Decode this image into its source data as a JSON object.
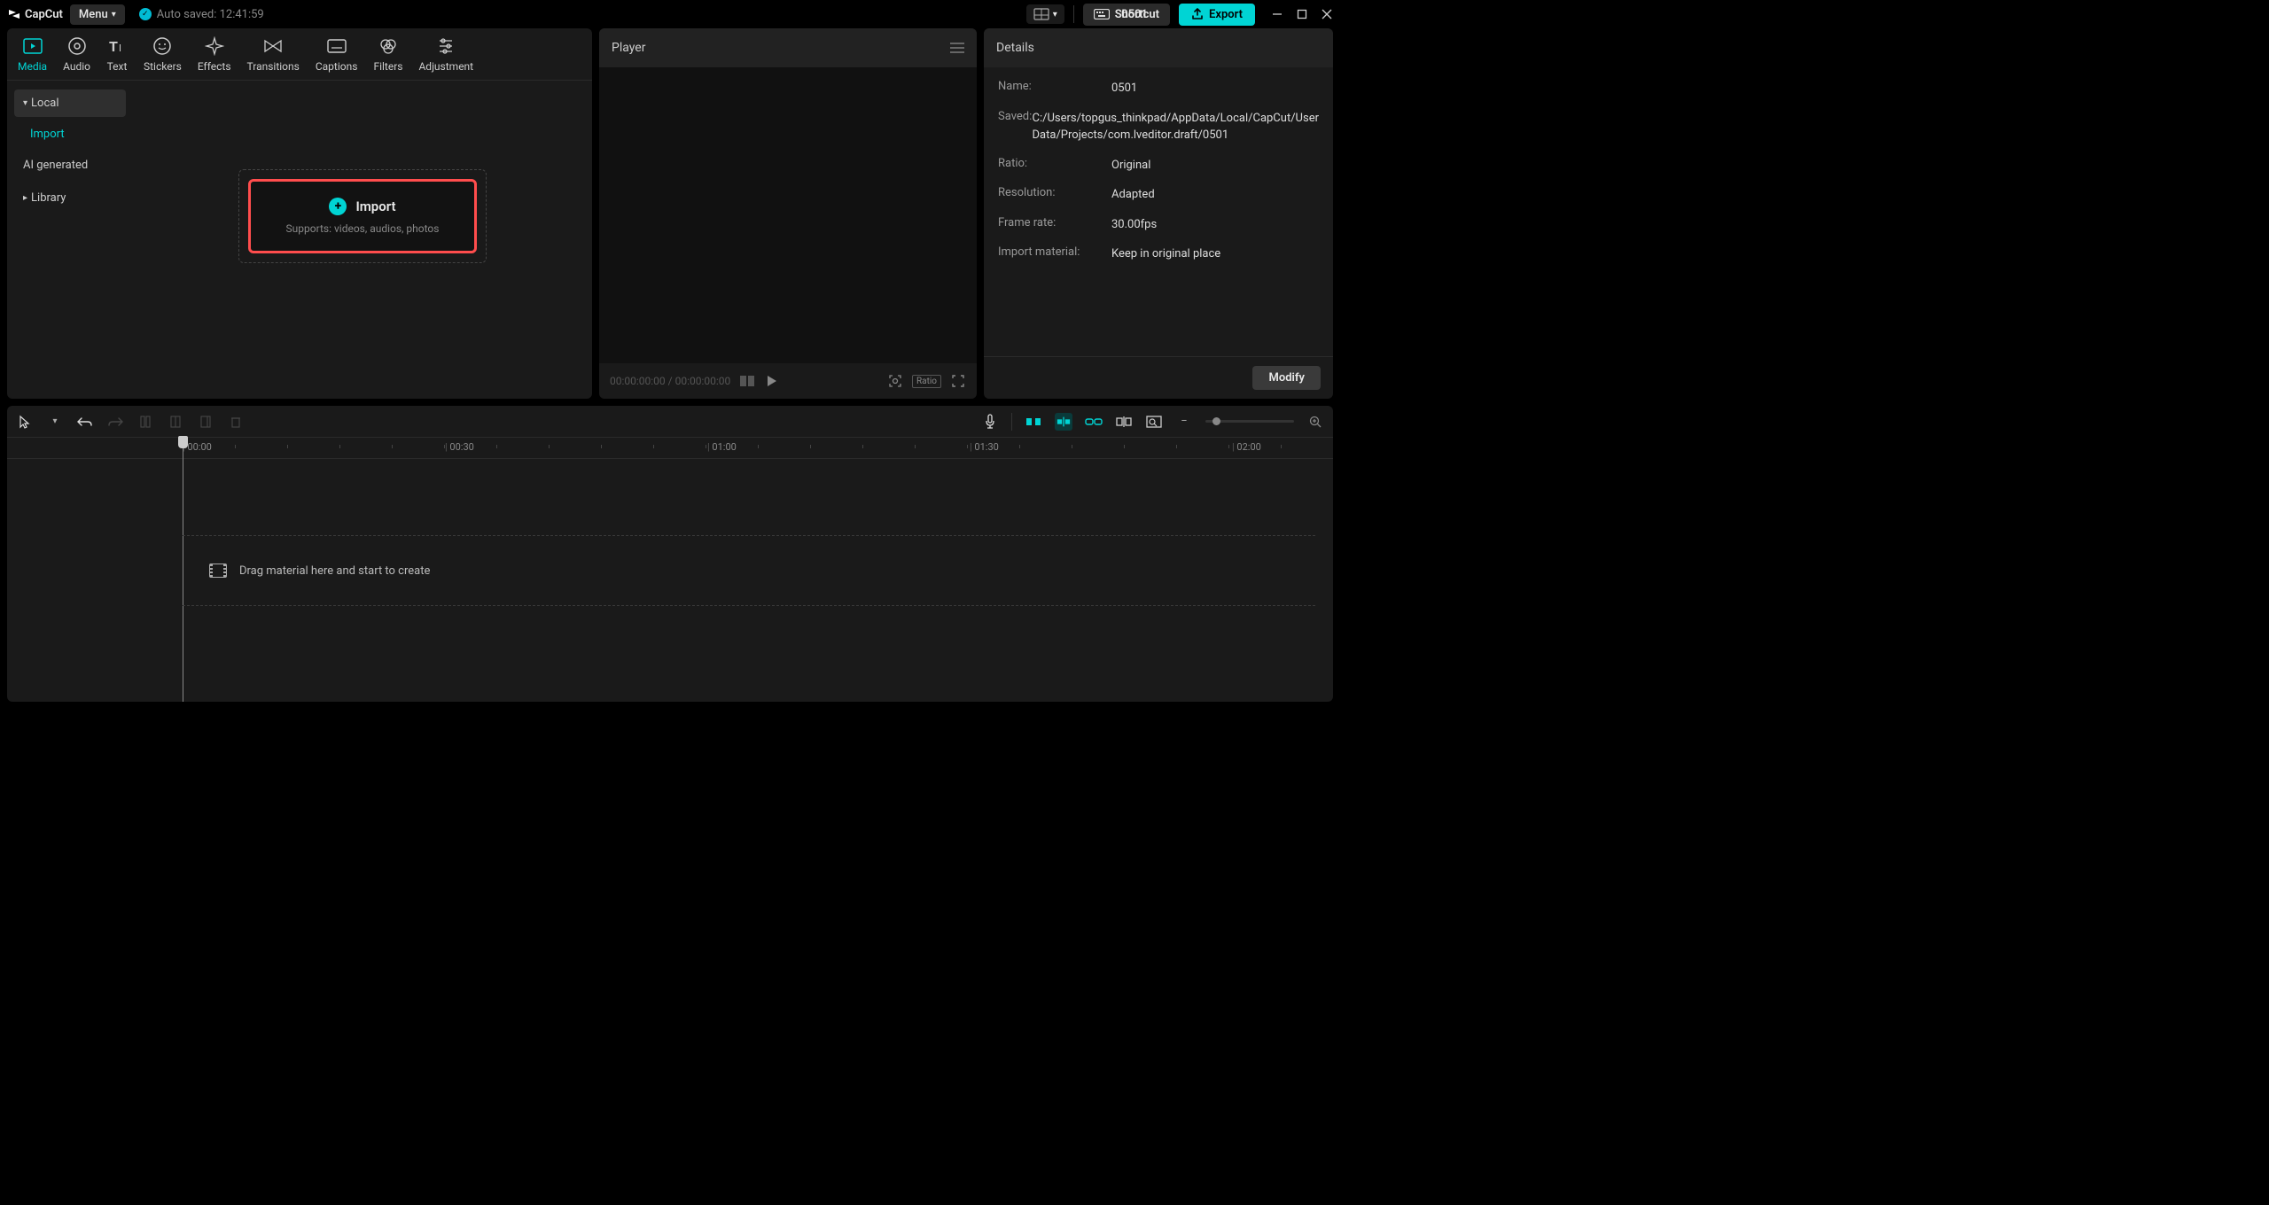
{
  "app": {
    "name": "CapCut",
    "menu": "Menu",
    "autosave": "Auto saved: 12:41:59",
    "project": "0501",
    "shortcut": "Shortcut",
    "export": "Export"
  },
  "tabs": [
    {
      "label": "Media",
      "active": true
    },
    {
      "label": "Audio"
    },
    {
      "label": "Text"
    },
    {
      "label": "Stickers"
    },
    {
      "label": "Effects"
    },
    {
      "label": "Transitions"
    },
    {
      "label": "Captions"
    },
    {
      "label": "Filters"
    },
    {
      "label": "Adjustment"
    }
  ],
  "sidebar": {
    "local": "Local",
    "import": "Import",
    "aigen": "AI generated",
    "library": "Library"
  },
  "importBox": {
    "title": "Import",
    "subtitle": "Supports: videos, audios, photos"
  },
  "player": {
    "title": "Player",
    "time": "00:00:00:00 / 00:00:00:00",
    "ratio": "Ratio"
  },
  "details": {
    "title": "Details",
    "rows": [
      {
        "label": "Name:",
        "value": "0501"
      },
      {
        "label": "Saved:",
        "value": "C:/Users/topgus_thinkpad/AppData/Local/CapCut/User Data/Projects/com.lveditor.draft/0501"
      },
      {
        "label": "Ratio:",
        "value": "Original"
      },
      {
        "label": "Resolution:",
        "value": "Adapted"
      },
      {
        "label": "Frame rate:",
        "value": "30.00fps"
      },
      {
        "label": "Import material:",
        "value": "Keep in original place"
      }
    ],
    "modify": "Modify"
  },
  "timeline": {
    "ticks": [
      "00:00",
      "00:30",
      "01:00",
      "01:30",
      "02:00"
    ],
    "dropHint": "Drag material here and start to create"
  }
}
